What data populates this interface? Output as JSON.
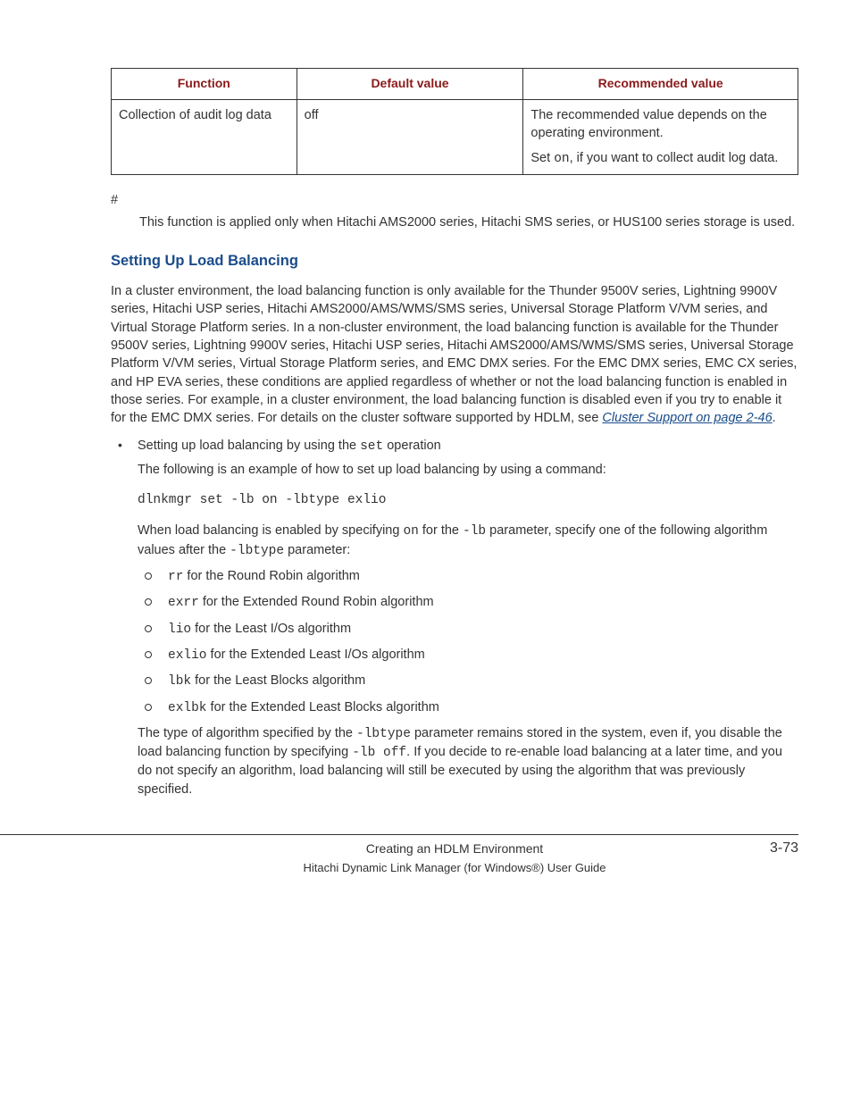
{
  "table": {
    "headers": [
      "Function",
      "Default value",
      "Recommended value"
    ],
    "row": {
      "function": "Collection of audit log data",
      "default": "off",
      "recommended1": "The recommended value depends on the operating environment.",
      "recommended2a": "Set ",
      "recommended2_code": "on",
      "recommended2b": ", if you want to collect audit log data."
    }
  },
  "hash": {
    "symbol": "#",
    "text": "This function is applied only when Hitachi AMS2000 series, Hitachi SMS series, or HUS100 series storage is used."
  },
  "heading": "Setting Up Load Balancing",
  "intro": {
    "part1": "In a cluster environment, the load balancing function is only available for the Thunder 9500V series, Lightning 9900V series, Hitachi USP series, Hitachi AMS2000/AMS/WMS/SMS series, Universal Storage Platform V/VM series, and Virtual Storage Platform series. In a non-cluster environment, the load balancing function is available for the Thunder 9500V series, Lightning 9900V series, Hitachi USP series, Hitachi AMS2000/AMS/WMS/SMS series, Universal Storage Platform V/VM series, Virtual Storage Platform series, and EMC DMX series. For the EMC DMX series, EMC CX series, and HP EVA series, these conditions are applied regardless of whether or not the load balancing function is enabled in those series. For example, in a cluster environment, the load balancing function is disabled even if you try to enable it for the EMC DMX series. For details on the cluster software supported by HDLM, see ",
    "link": "Cluster Support on page 2-46",
    "part2": "."
  },
  "bullet": {
    "line1a": "Setting up load balancing by using the ",
    "line1_code": "set",
    "line1b": " operation",
    "line2": "The following is an example of how to set up load balancing by using a command:",
    "cmd": "dlnkmgr set -lb on -lbtype exlio",
    "line3a": "When load balancing is enabled by specifying ",
    "line3_c1": "on",
    "line3b": " for the ",
    "line3_c2": "-lb",
    "line3c": " parameter, specify one of the following algorithm values after the ",
    "line3_c3": "-lbtype",
    "line3d": " parameter:",
    "algos": [
      {
        "code": "rr",
        "text": " for the Round Robin algorithm"
      },
      {
        "code": "exrr",
        "text": " for the Extended Round Robin algorithm"
      },
      {
        "code": "lio",
        "text": " for the Least I/Os algorithm"
      },
      {
        "code": "exlio",
        "text": " for the Extended Least I/Os algorithm"
      },
      {
        "code": "lbk",
        "text": " for the Least Blocks algorithm"
      },
      {
        "code": "exlbk",
        "text": " for the Extended Least Blocks algorithm"
      }
    ],
    "line4a": "The type of algorithm specified by the ",
    "line4_c1": "-lbtype",
    "line4b": " parameter remains stored in the system, even if, you disable the load balancing function by specifying ",
    "line4_c2": "-lb off",
    "line4c": ". If you decide to re-enable load balancing at a later time, and you do not specify an algorithm, load balancing will still be executed by using the algorithm that was previously specified."
  },
  "footer": {
    "line1": "Creating an HDLM Environment",
    "pagenum": "3-73",
    "line2": "Hitachi Dynamic Link Manager (for Windows®) User Guide"
  }
}
